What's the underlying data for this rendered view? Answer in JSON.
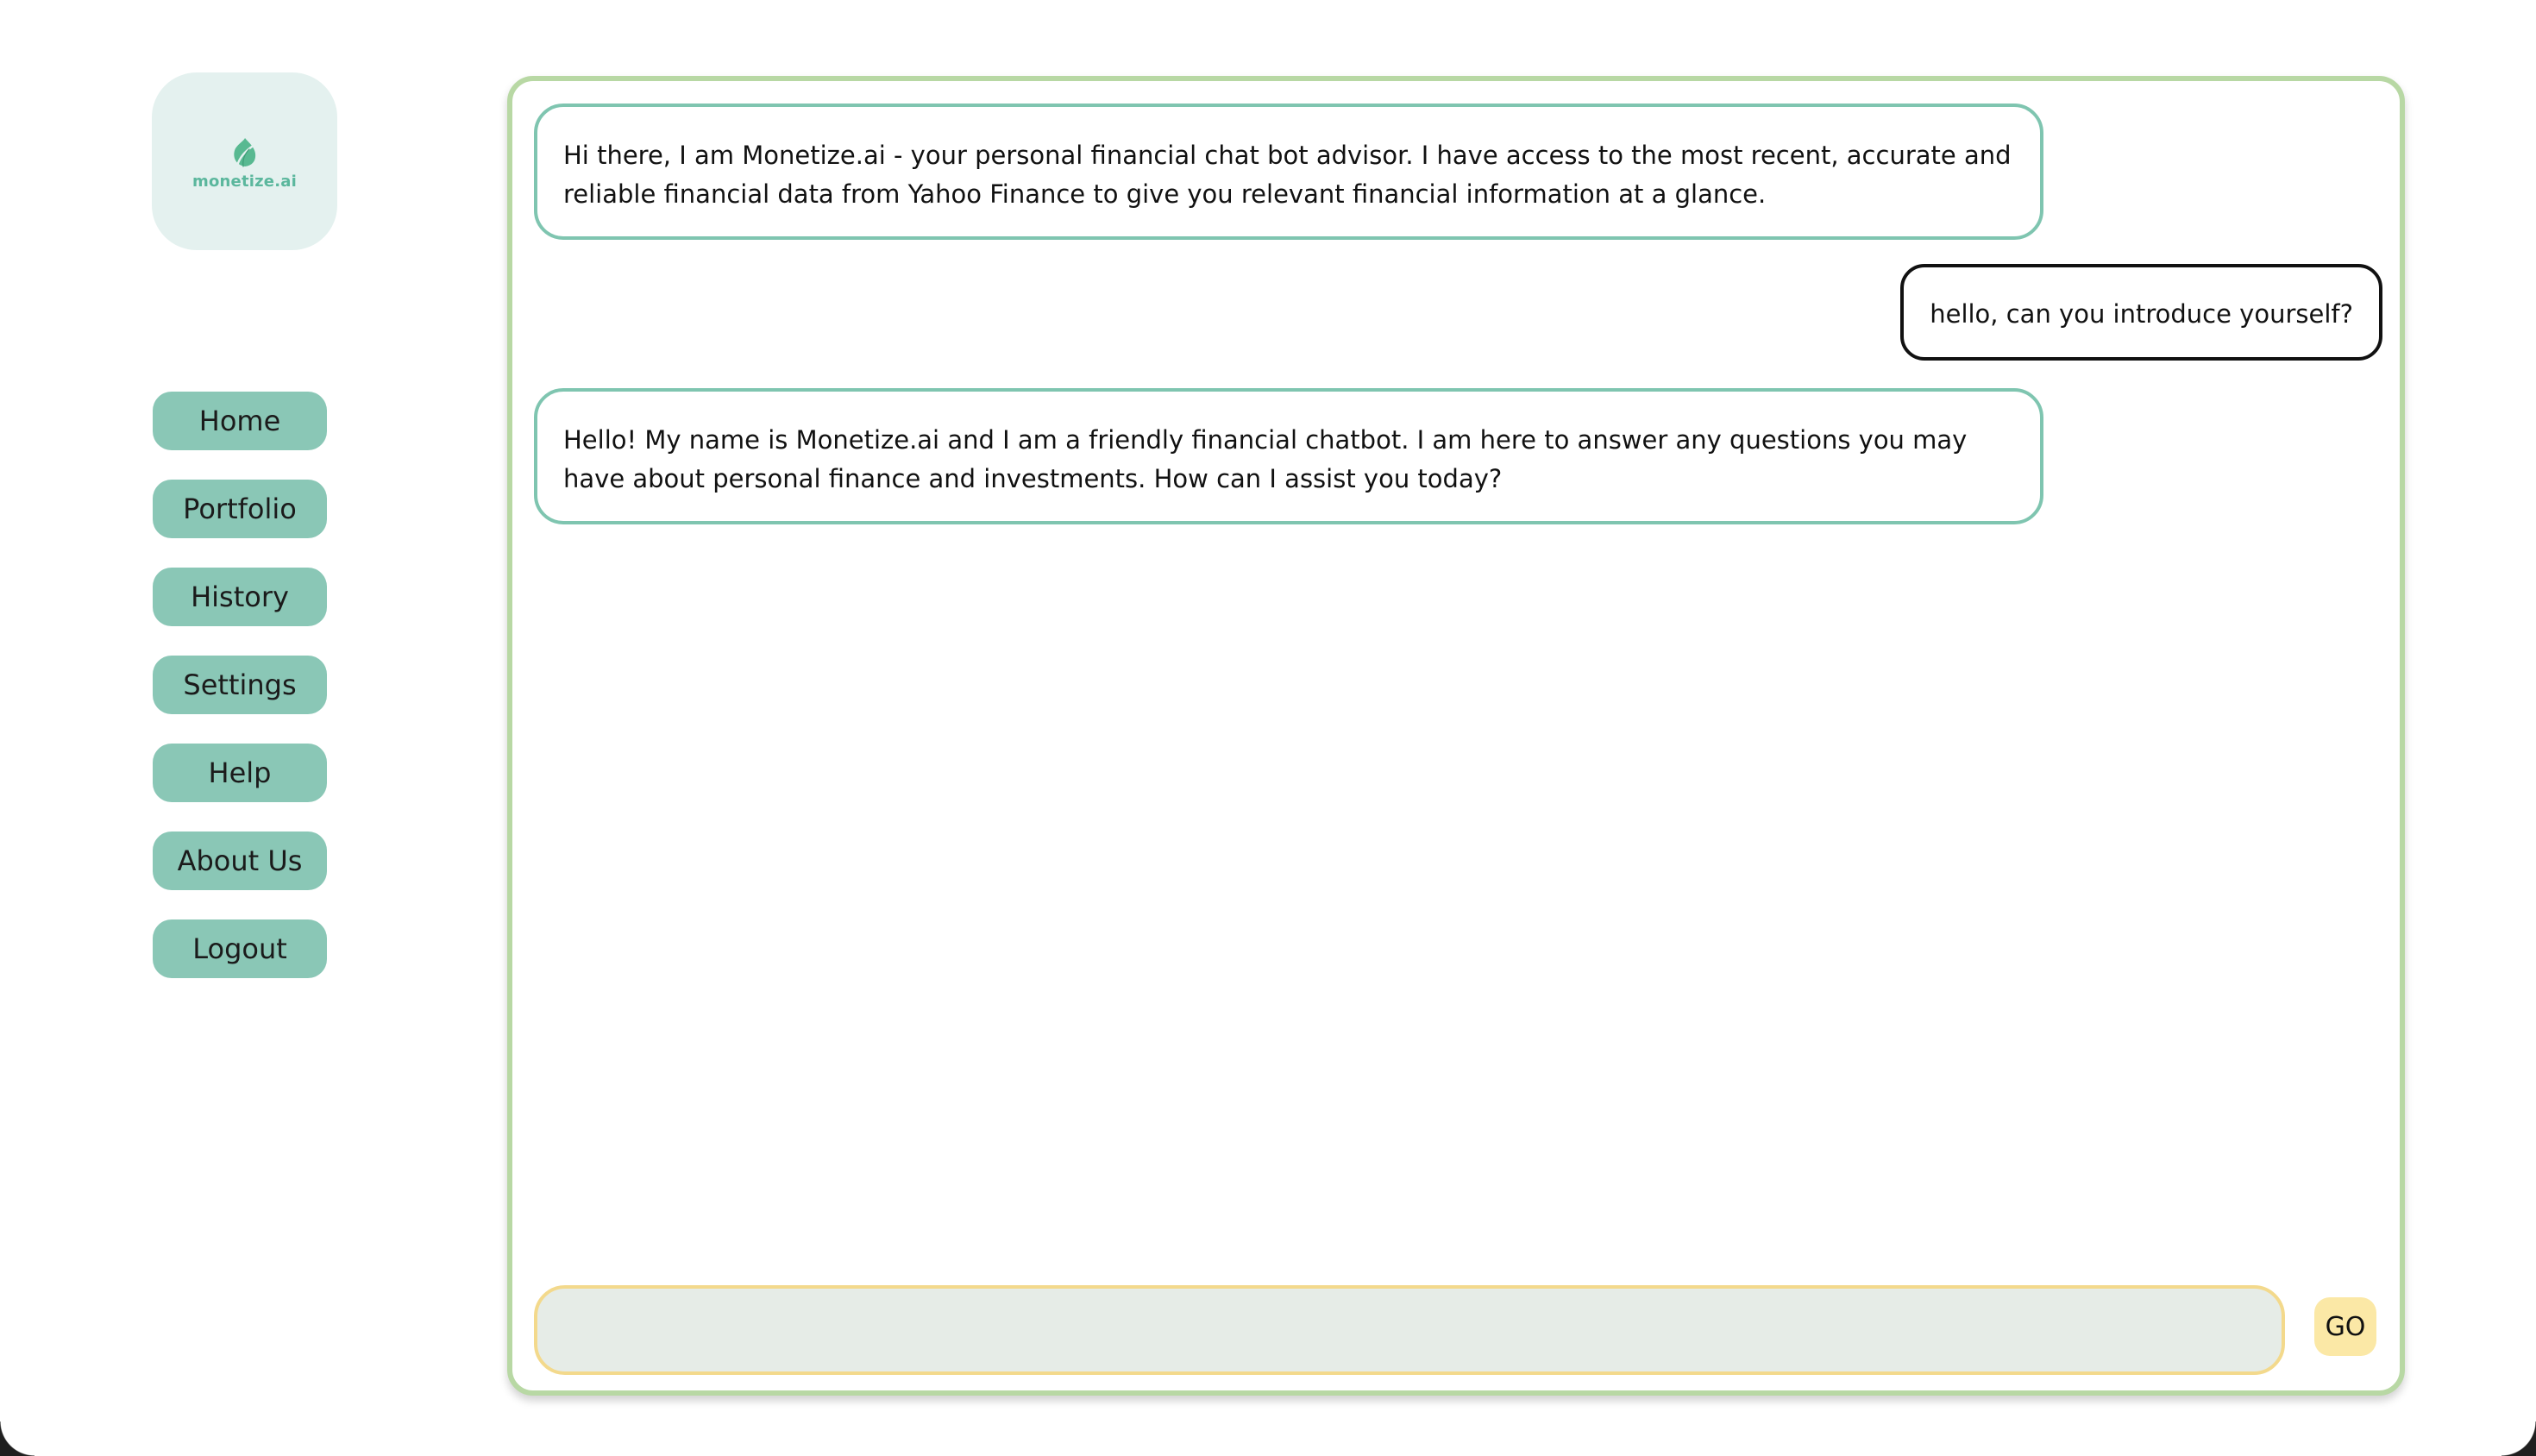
{
  "logo": {
    "text": "monetize.ai",
    "icon": "leaf-icon",
    "accent_color": "#5bb79d"
  },
  "sidebar": {
    "items": [
      {
        "label": "Home"
      },
      {
        "label": "Portfolio"
      },
      {
        "label": "History"
      },
      {
        "label": "Settings"
      },
      {
        "label": "Help"
      },
      {
        "label": "About Us"
      },
      {
        "label": "Logout"
      }
    ],
    "button_color": "#8ac7b6"
  },
  "chat": {
    "messages": [
      {
        "role": "bot",
        "text": "Hi there, I am Monetize.ai - your personal financial chat bot advisor. I have access to the most recent, accurate and reliable financial data from Yahoo Finance to give you relevant financial information at a glance."
      },
      {
        "role": "user",
        "text": "hello, can you introduce yourself?"
      },
      {
        "role": "bot",
        "text": "Hello! My name is Monetize.ai and I am a friendly financial chatbot. I am here to answer any questions you may have about personal finance and investments. How can I assist you today?"
      }
    ],
    "input": {
      "value": "",
      "placeholder": ""
    },
    "send_label": "GO",
    "panel_border_color": "#b8d8a4",
    "bot_bubble_border_color": "#7fc5b0",
    "user_bubble_border_color": "#111111",
    "input_border_color": "#f3d98c",
    "send_button_color": "#fbe8a6"
  }
}
